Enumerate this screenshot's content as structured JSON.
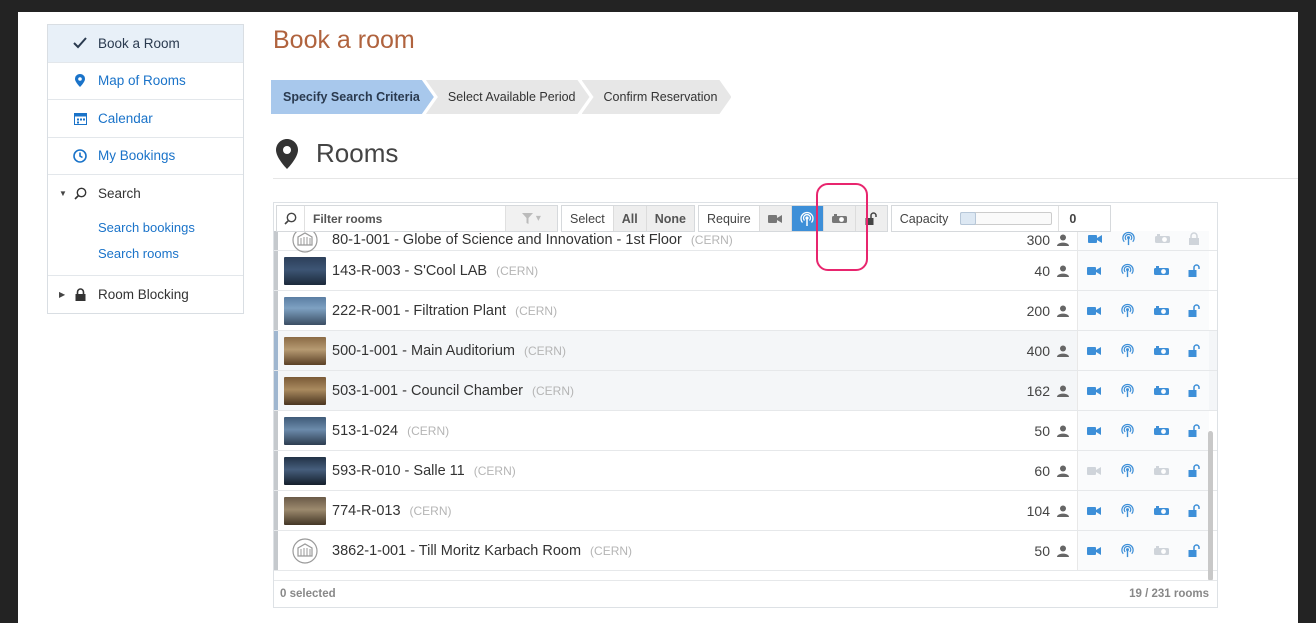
{
  "sidebar": {
    "items": [
      {
        "label": "Book a Room"
      },
      {
        "label": "Map of Rooms"
      },
      {
        "label": "Calendar"
      },
      {
        "label": "My Bookings"
      },
      {
        "label": "Search"
      },
      {
        "label": "Room Blocking"
      }
    ],
    "search_sub": [
      {
        "label": "Search bookings"
      },
      {
        "label": "Search rooms"
      }
    ]
  },
  "page": {
    "title": "Book a room"
  },
  "wizard": {
    "steps": [
      {
        "label": "Specify Search Criteria"
      },
      {
        "label": "Select Available Period"
      },
      {
        "label": "Confirm Reservation"
      }
    ]
  },
  "rooms": {
    "heading": "Rooms",
    "toolbar": {
      "filter_placeholder": "Filter rooms",
      "select_label": "Select",
      "all_label": "All",
      "none_label": "None",
      "require_label": "Require",
      "capacity_label": "Capacity",
      "capacity_value": "0",
      "require_filters": [
        {
          "icon": "video-camera-icon",
          "active": false
        },
        {
          "icon": "webcast-icon",
          "active": true
        },
        {
          "icon": "projector-icon",
          "active": false
        },
        {
          "icon": "unlock-icon",
          "active": false
        }
      ]
    },
    "list": [
      {
        "name": "80-1-001 - Globe of Science and Innovation - 1st Floor",
        "site": "(CERN)",
        "capacity": "300",
        "thumb": "building",
        "video": true,
        "projector": false,
        "unlocked": false
      },
      {
        "name": "143-R-003 - S'Cool LAB",
        "site": "(CERN)",
        "capacity": "40",
        "thumb": "photo",
        "video": true,
        "projector": true,
        "unlocked": true
      },
      {
        "name": "222-R-001 - Filtration Plant",
        "site": "(CERN)",
        "capacity": "200",
        "thumb": "photo",
        "video": true,
        "projector": true,
        "unlocked": true
      },
      {
        "name": "500-1-001 - Main Auditorium",
        "site": "(CERN)",
        "capacity": "400",
        "thumb": "photo",
        "video": true,
        "projector": true,
        "unlocked": true
      },
      {
        "name": "503-1-001 - Council Chamber",
        "site": "(CERN)",
        "capacity": "162",
        "thumb": "photo",
        "video": true,
        "projector": true,
        "unlocked": true
      },
      {
        "name": "513-1-024",
        "site": "(CERN)",
        "capacity": "50",
        "thumb": "photo",
        "video": true,
        "projector": true,
        "unlocked": true
      },
      {
        "name": "593-R-010 - Salle 11",
        "site": "(CERN)",
        "capacity": "60",
        "thumb": "photo",
        "video": false,
        "projector": false,
        "unlocked": true
      },
      {
        "name": "774-R-013",
        "site": "(CERN)",
        "capacity": "104",
        "thumb": "photo",
        "video": true,
        "projector": true,
        "unlocked": true
      },
      {
        "name": "3862-1-001 - Till Moritz Karbach Room",
        "site": "(CERN)",
        "capacity": "50",
        "thumb": "building",
        "video": true,
        "projector": false,
        "unlocked": true
      }
    ],
    "footer": {
      "selected": "0 selected",
      "count": "19 / 231 rooms"
    }
  },
  "colors": {
    "accent": "#1a73c9",
    "title": "#b0633e",
    "highlight_ring": "#e8256e",
    "active_filter": "#3d8fd8",
    "step_active": "#a8c8ec"
  }
}
